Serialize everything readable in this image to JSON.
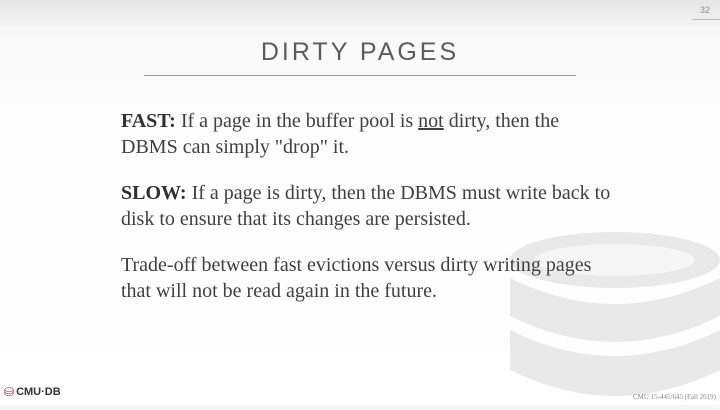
{
  "slide_number": "32",
  "title": "DIRTY PAGES",
  "paragraphs": [
    {
      "label": "FAST:",
      "pre": " If a page in the buffer pool is ",
      "underlined": "not",
      "post": " dirty, then the DBMS can simply \"drop\" it."
    },
    {
      "label": "SLOW:",
      "text": " If a page is dirty, then the DBMS must write back to disk to ensure that its changes are persisted."
    },
    {
      "text": "Trade-off between fast evictions versus dirty writing pages that will not be read again in the future."
    }
  ],
  "logo": {
    "mark": "⛁",
    "text": "CMU·DB"
  },
  "footer": "CMU 15-445/645 (Fall 2019)",
  "colors": {
    "title": "#5c5c5c",
    "logo_mark": "#b51f2e",
    "watermark": "#e8e8e8"
  },
  "icons": {
    "watermark": "database-icon",
    "logo": "cmu-db-logo-icon"
  }
}
